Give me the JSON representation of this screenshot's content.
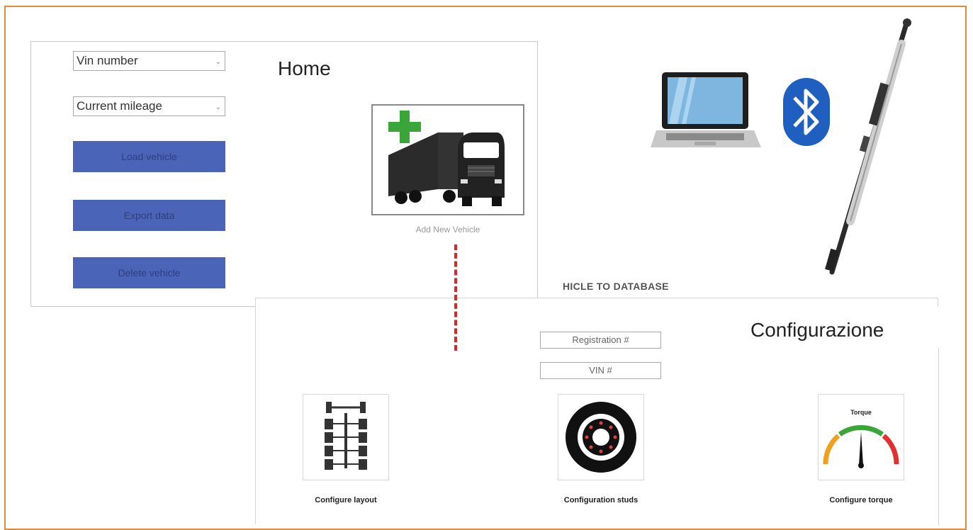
{
  "home": {
    "title": "Home",
    "vin_select": "Vin number",
    "mileage_select": "Current mileage",
    "buttons": {
      "load": "Load vehicle",
      "export": "Export data",
      "delete": "Delete vehicle"
    },
    "add_vehicle_label": "Add New Vehicle"
  },
  "banner_text": "HICLE TO DATABASE",
  "config": {
    "title": "Configurazione",
    "registration_field": "Registration #",
    "vin_field": "VIN #",
    "tiles": {
      "layout": "Configure layout",
      "studs": "Configuration studs",
      "torque": "Configure torque",
      "torque_gauge_title": "Torque"
    }
  },
  "colors": {
    "frame": "#e08a3c",
    "button": "#4a64b8",
    "dashed_line": "#d62828",
    "plus": "#3aa63a"
  },
  "icons": [
    "truck-icon",
    "plus-icon",
    "laptop-icon",
    "bluetooth-icon",
    "torque-wrench-icon",
    "axle-layout-icon",
    "wheel-studs-icon",
    "torque-gauge-icon"
  ]
}
